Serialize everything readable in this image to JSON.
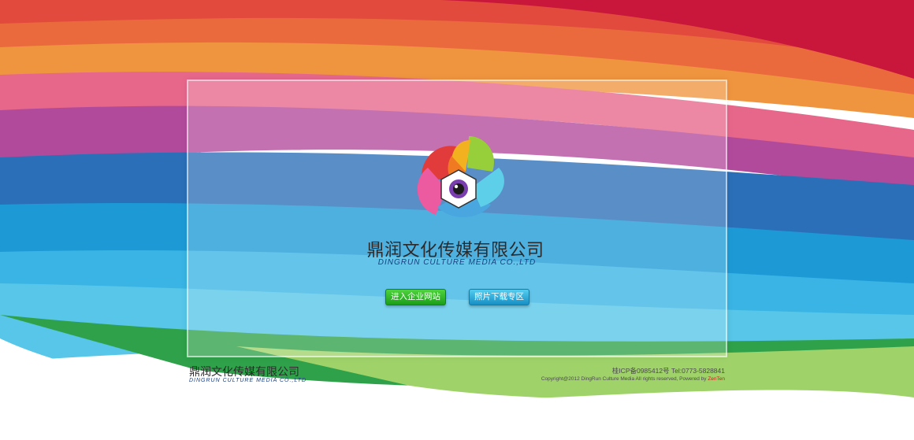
{
  "brand": {
    "name_cn": "鼎润文化传媒有限公司",
    "name_en": "DINGRUN CULTURE MEDIA CO.,LTD"
  },
  "buttons": {
    "enter_site": "进入企业网站",
    "photo_download": "照片下载专区"
  },
  "footer": {
    "name_cn": "鼎润文化传媒有限公司",
    "name_en": "DINGRUN CULTURE MEDIA CO.,LTD",
    "icp": "桂ICP备0985412号 Tel:0773-5828841",
    "copyright": "Copyright@2012 DingRun Culture Media All rights reserved, Powered by",
    "powered_by": "ZenTen"
  },
  "colors": {
    "green_button": "#2fb52a",
    "blue_button": "#2ab0e0",
    "text_dark": "#2c2a2a",
    "text_blue": "#1b3f7e"
  }
}
